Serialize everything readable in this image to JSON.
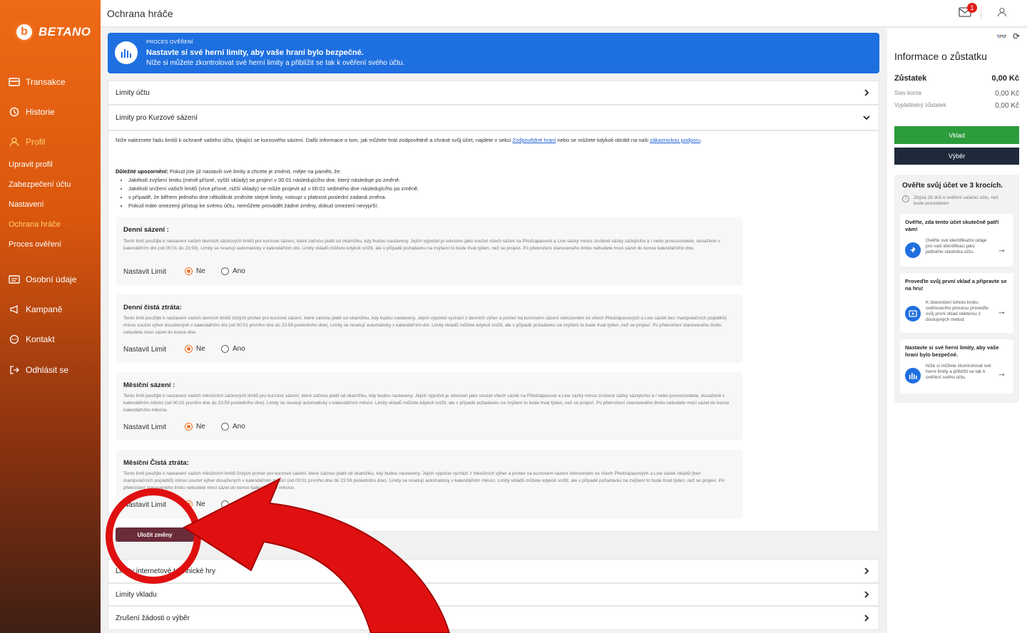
{
  "topbar": {
    "title": "Ochrana hráče",
    "mail_badge": "1"
  },
  "logo": {
    "brand": "BETANO",
    "ball": "b"
  },
  "sidebar": {
    "items": [
      {
        "label": "Transakce"
      },
      {
        "label": "Historie"
      },
      {
        "label": "Profil"
      },
      {
        "label": "Osobní údaje"
      },
      {
        "label": "Kampaně"
      },
      {
        "label": "Kontakt"
      },
      {
        "label": "Odhlásit se"
      }
    ],
    "sub": [
      {
        "label": "Upravit profil"
      },
      {
        "label": "Zabezpečení účtu"
      },
      {
        "label": "Nastavení"
      },
      {
        "label": "Ochrana hráče"
      },
      {
        "label": "Proces ověření"
      }
    ]
  },
  "banner": {
    "kicker": "PROCES OVĚŘENÍ",
    "heading": "Nastavte si své herní limity, aby vaše hraní bylo bezpečné.",
    "text": "Níže si můžete zkontrolovat své herní limity a přiblížit se tak k ověření svého účtu."
  },
  "rows": {
    "account_limits": "Limity účtu",
    "odds_limits": "Limity pro Kurzové sázení",
    "internet_games": "Limity internetové technické hry",
    "deposit_limits": "Limity vkladu",
    "cancel_withdrawal": "Zrušení žádosti o výběr"
  },
  "intro": {
    "text1": "Níže naleznete řadu limitů k ochraně vašeho účtu, týkající se kurzového sázení. Další informace o tom, jak můžete hrát zodpovědně a chránit svůj účet, najdete v sekci ",
    "link1": "Zodpovědné hraní",
    "text2": " nebo se můžete kdykoli obrátit na naši ",
    "link2": "zákaznickou podporu",
    "text3": "."
  },
  "warning": {
    "title": "Důležité upozornění:",
    "lead": " Pokud jste již nastavili své limity a chcete je změnit, mějte na paměti, že:",
    "bullets": [
      "Jakékoli zvýšení limitu (méně přísné, vyšší vklady) se projeví v 00:01 následujícího dne, který následuje po změně.",
      "Jakékoli snížení vašich limitů (více přísné, nižší vklady) se může projevit až v 00:01 sedmého dne následujícího po změně.",
      "v případě, že během jednoho dne několikrát změníte stejné limity, vstoupí v platnost poslední zadaná změna.",
      "Pokud máte omezený přístup ke svému účtu, nemůžete provádět žádné změny, dokud omezení nevyprší."
    ]
  },
  "limits": [
    {
      "title": "Denní sázení  :",
      "desc": "Tento limit použijte k nastavení vašich denních sázkových limitů pro kurzové sázení, které začnou platit od okamžiku, kdy budou nastaveny. Jejich výpočet je odvozen jako součet všech sázek na Předzápasové a Live sázky minus zrušené sázky sázejícího a / nebo provozovatele, dosažené v kalendářním dni (od 00:01 do 23:59). Limity se resetují automaticky v kalendářním dni. Limity vkladů můžete kdykoli snížit, ale v případě požadavku na zvýšení to bude trvat týden, než se projeví. Po překročení stanoveného limitu nebudete moci sázet do konce kalendářního dne.",
      "label": "Nastavit Limit",
      "no": "Ne",
      "yes": "Ano"
    },
    {
      "title": "Denní čistá ztráta:",
      "desc": "Tento limit použijte k nastavení vašich denních limitů čistých proher pro kurzové sázení, které začnou platit od okamžiku, kdy budou nastaveny. Jejich výpočet vychází z denních výher a proher na kurzovém sázení odvozeném ze všech Předzápasových a Live sázek bez manipulačních poplatků) minus součet výher dosažených v kalendářním dni (od 00:01 prvního dne do 23:59 posledního dne). Limity se resetují automaticky v kalendářním dni. Limity vkladů můžete kdykoli snížit, ale v případě požadavku na zvýšení to bude trvat týden, než se projeví. Po překročení stanoveného limitu nebudete moci sázet do konce dne.",
      "label": "Nastavit Limit",
      "no": "Ne",
      "yes": "Ano"
    },
    {
      "title": "Měsíční sázení  :",
      "desc": "Tento limit použijte k nastavení vašich měsíčních sázkových limitů pro kurzové sázení, které začnou platit od okamžiku, kdy budou nastaveny. Jejich výpočet je odvozen jako součet všech sázek na Předzápasové a Live sázky minus zrušené sázky sázejícího a / nebo provozovatele, dosažené v kalendářním měsíci (od 00:01 prvního dne do 23:59 posledního dne). Limity se resetují automaticky v kalendářním měsíci. Limity vkladů můžete kdykoli snížit, ale v případě požadavku na zvýšení to bude trvat týden, než se projeví. Po překročení stanoveného limitu nebudete moci sázet do konce kalendářního měsíce.",
      "label": "Nastavit Limit",
      "no": "Ne",
      "yes": "Ano"
    },
    {
      "title": "Měsíční Čistá ztráta:",
      "desc": "Tento limit použijte k nastavení vašich měsíčních limitů čistých proher pro kurzové sázení, které začnou platit od okamžiku, kdy budou nastaveny. Jejich výpočet vychází z měsíčních výher a proher na kurzovém sázení odvozeném ze všech Předzápasových a Live sázek vkladů (bez manipulačních poplatků) minus součet výher dosažených v kalendářním měsíci (od 00:01 prvního dne do 23:59 posledního dne). Limity se resetují automaticky v kalendářním měsíci. Limity vkladů můžete kdykoli snížit, ale v případě požadavku na zvýšení to bude trvat týden, než se projeví. Po překročení stanoveného limitu nebudete moci sázet do konce kalendářního měsíce.",
      "label": "Nastavit Limit",
      "no": "Ne",
      "yes": "Ano"
    }
  ],
  "save_label": "Uložit změny",
  "right": {
    "title": "Informace o zůstatku",
    "balance_label": "Zůstatek",
    "balance": "0,00 Kč",
    "account_label": "Stav konta",
    "account": "0,00 Kč",
    "withdrawable_label": "Vyplatitelný zůstatek",
    "withdrawable": "0,00 Kč",
    "deposit": "Vklad",
    "withdraw": "Výběr",
    "verify_title": "Ověřte svůj účet ve 3 krocích.",
    "verify_note": "Zbývá 29 dnů k ověření vašeho účtu, než bude pozastaven",
    "cards": [
      {
        "title": "Ověřte, zda tento účet skutečně patří vám!",
        "desc": "Ověřte své identifikační údaje pro vaši identifikaci jako jediného vlastníka účtu."
      },
      {
        "title": "Proveďte svůj první vklad a připravte se na hru!",
        "desc": "K dokončení tohoto kroku ověřovacího procesu proveďte svůj první vklad některou z dostupných metod."
      },
      {
        "title": "Nastavte si své herní limity, aby vaše hraní bylo bezpečné.",
        "desc": "Níže si můžete zkontrolovat své herní limity a přiblížit se tak k ověření svého účtu."
      }
    ]
  },
  "colors": {
    "accent": "#f37021",
    "banner": "#1e6fe0",
    "save": "#6b2c3a",
    "deposit": "#2b9b3b",
    "annotation": "#e01010"
  }
}
